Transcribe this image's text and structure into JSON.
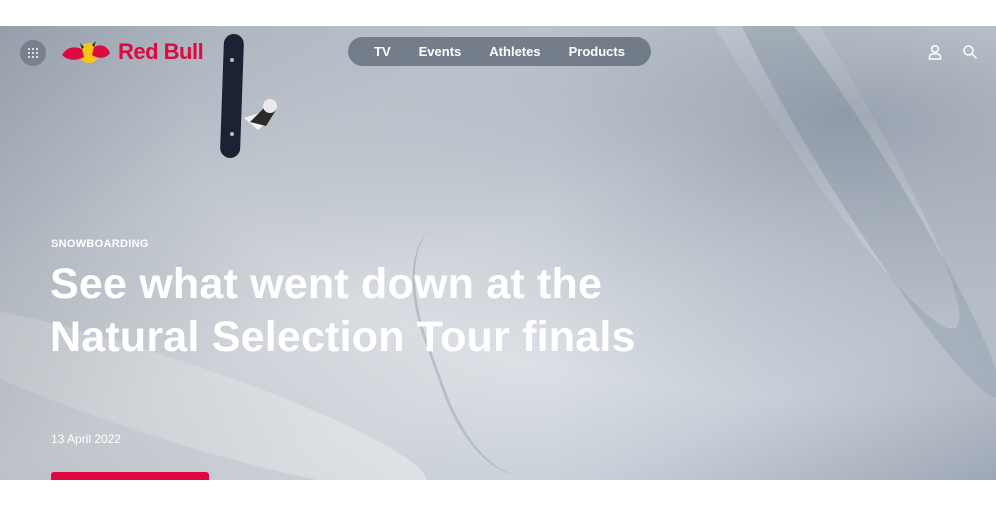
{
  "brand": {
    "name": "Red Bull",
    "accent": "#db0a40"
  },
  "nav": {
    "links": [
      "TV",
      "Events",
      "Athletes",
      "Products"
    ],
    "menu_icon": "grid-menu-icon",
    "account_icon": "user-icon",
    "search_icon": "search-icon"
  },
  "hero": {
    "category": "SNOWBOARDING",
    "headline": "See what went down at the Natural Selection Tour finals",
    "date": "13 April 2022"
  }
}
